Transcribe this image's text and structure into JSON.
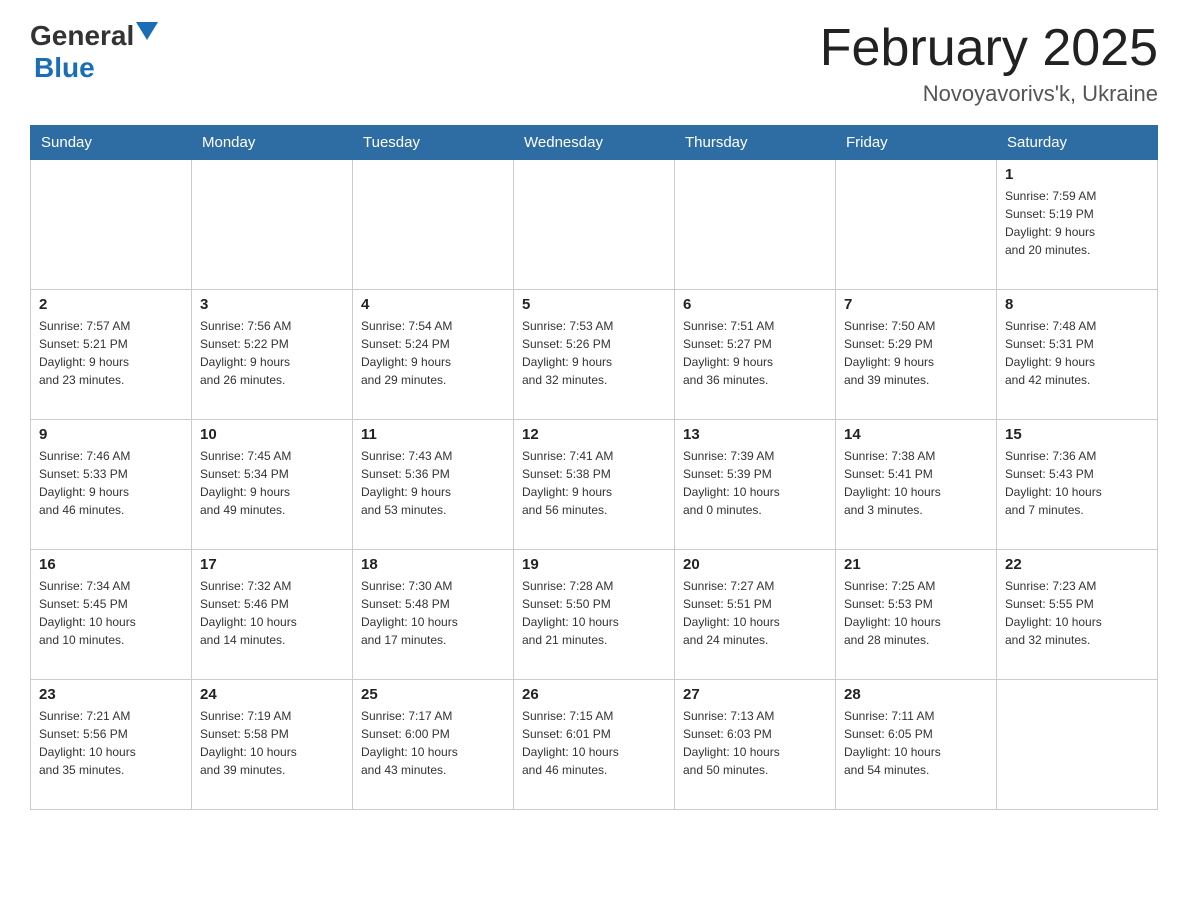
{
  "header": {
    "logo_general": "General",
    "logo_blue": "Blue",
    "month_title": "February 2025",
    "location": "Novoyavorivs'k, Ukraine"
  },
  "days_of_week": [
    "Sunday",
    "Monday",
    "Tuesday",
    "Wednesday",
    "Thursday",
    "Friday",
    "Saturday"
  ],
  "weeks": [
    [
      {
        "num": "",
        "info": ""
      },
      {
        "num": "",
        "info": ""
      },
      {
        "num": "",
        "info": ""
      },
      {
        "num": "",
        "info": ""
      },
      {
        "num": "",
        "info": ""
      },
      {
        "num": "",
        "info": ""
      },
      {
        "num": "1",
        "info": "Sunrise: 7:59 AM\nSunset: 5:19 PM\nDaylight: 9 hours\nand 20 minutes."
      }
    ],
    [
      {
        "num": "2",
        "info": "Sunrise: 7:57 AM\nSunset: 5:21 PM\nDaylight: 9 hours\nand 23 minutes."
      },
      {
        "num": "3",
        "info": "Sunrise: 7:56 AM\nSunset: 5:22 PM\nDaylight: 9 hours\nand 26 minutes."
      },
      {
        "num": "4",
        "info": "Sunrise: 7:54 AM\nSunset: 5:24 PM\nDaylight: 9 hours\nand 29 minutes."
      },
      {
        "num": "5",
        "info": "Sunrise: 7:53 AM\nSunset: 5:26 PM\nDaylight: 9 hours\nand 32 minutes."
      },
      {
        "num": "6",
        "info": "Sunrise: 7:51 AM\nSunset: 5:27 PM\nDaylight: 9 hours\nand 36 minutes."
      },
      {
        "num": "7",
        "info": "Sunrise: 7:50 AM\nSunset: 5:29 PM\nDaylight: 9 hours\nand 39 minutes."
      },
      {
        "num": "8",
        "info": "Sunrise: 7:48 AM\nSunset: 5:31 PM\nDaylight: 9 hours\nand 42 minutes."
      }
    ],
    [
      {
        "num": "9",
        "info": "Sunrise: 7:46 AM\nSunset: 5:33 PM\nDaylight: 9 hours\nand 46 minutes."
      },
      {
        "num": "10",
        "info": "Sunrise: 7:45 AM\nSunset: 5:34 PM\nDaylight: 9 hours\nand 49 minutes."
      },
      {
        "num": "11",
        "info": "Sunrise: 7:43 AM\nSunset: 5:36 PM\nDaylight: 9 hours\nand 53 minutes."
      },
      {
        "num": "12",
        "info": "Sunrise: 7:41 AM\nSunset: 5:38 PM\nDaylight: 9 hours\nand 56 minutes."
      },
      {
        "num": "13",
        "info": "Sunrise: 7:39 AM\nSunset: 5:39 PM\nDaylight: 10 hours\nand 0 minutes."
      },
      {
        "num": "14",
        "info": "Sunrise: 7:38 AM\nSunset: 5:41 PM\nDaylight: 10 hours\nand 3 minutes."
      },
      {
        "num": "15",
        "info": "Sunrise: 7:36 AM\nSunset: 5:43 PM\nDaylight: 10 hours\nand 7 minutes."
      }
    ],
    [
      {
        "num": "16",
        "info": "Sunrise: 7:34 AM\nSunset: 5:45 PM\nDaylight: 10 hours\nand 10 minutes."
      },
      {
        "num": "17",
        "info": "Sunrise: 7:32 AM\nSunset: 5:46 PM\nDaylight: 10 hours\nand 14 minutes."
      },
      {
        "num": "18",
        "info": "Sunrise: 7:30 AM\nSunset: 5:48 PM\nDaylight: 10 hours\nand 17 minutes."
      },
      {
        "num": "19",
        "info": "Sunrise: 7:28 AM\nSunset: 5:50 PM\nDaylight: 10 hours\nand 21 minutes."
      },
      {
        "num": "20",
        "info": "Sunrise: 7:27 AM\nSunset: 5:51 PM\nDaylight: 10 hours\nand 24 minutes."
      },
      {
        "num": "21",
        "info": "Sunrise: 7:25 AM\nSunset: 5:53 PM\nDaylight: 10 hours\nand 28 minutes."
      },
      {
        "num": "22",
        "info": "Sunrise: 7:23 AM\nSunset: 5:55 PM\nDaylight: 10 hours\nand 32 minutes."
      }
    ],
    [
      {
        "num": "23",
        "info": "Sunrise: 7:21 AM\nSunset: 5:56 PM\nDaylight: 10 hours\nand 35 minutes."
      },
      {
        "num": "24",
        "info": "Sunrise: 7:19 AM\nSunset: 5:58 PM\nDaylight: 10 hours\nand 39 minutes."
      },
      {
        "num": "25",
        "info": "Sunrise: 7:17 AM\nSunset: 6:00 PM\nDaylight: 10 hours\nand 43 minutes."
      },
      {
        "num": "26",
        "info": "Sunrise: 7:15 AM\nSunset: 6:01 PM\nDaylight: 10 hours\nand 46 minutes."
      },
      {
        "num": "27",
        "info": "Sunrise: 7:13 AM\nSunset: 6:03 PM\nDaylight: 10 hours\nand 50 minutes."
      },
      {
        "num": "28",
        "info": "Sunrise: 7:11 AM\nSunset: 6:05 PM\nDaylight: 10 hours\nand 54 minutes."
      },
      {
        "num": "",
        "info": ""
      }
    ]
  ]
}
